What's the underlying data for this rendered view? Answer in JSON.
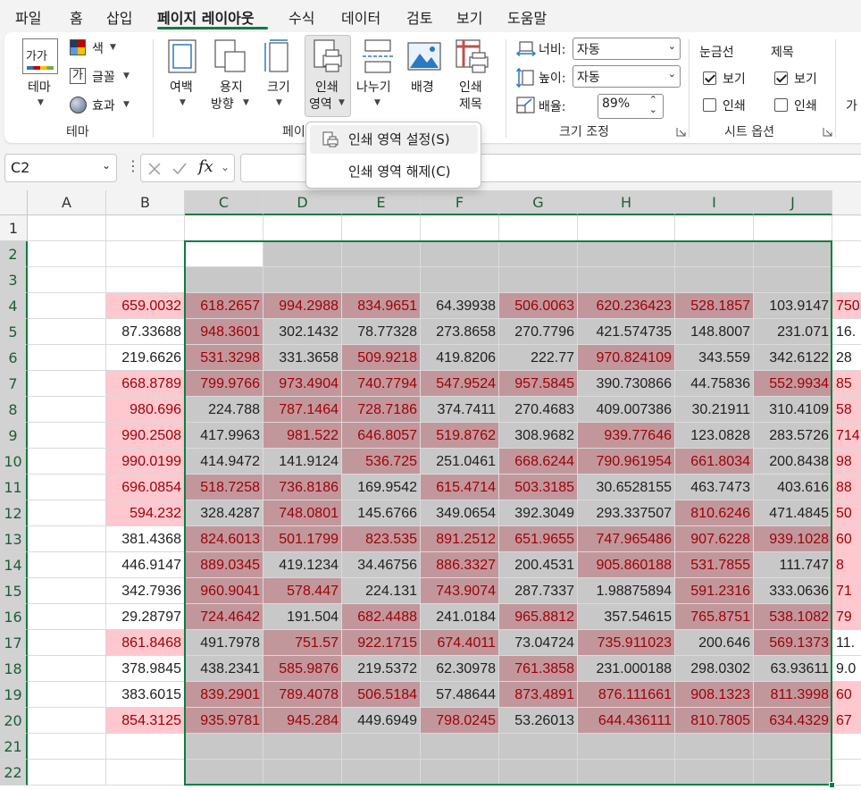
{
  "menu": {
    "tabs": [
      "파일",
      "홈",
      "삽입",
      "페이지 레이아웃",
      "수식",
      "데이터",
      "검토",
      "보기",
      "도움말"
    ],
    "active_index": 3
  },
  "ribbon": {
    "theme": {
      "main_label": "테마",
      "colors_label": "색",
      "fonts_label": "글꼴",
      "effects_label": "효과",
      "group_label": "테마",
      "thumb_text": "가가"
    },
    "page_setup": {
      "margins_label": "여백",
      "orientation_l1": "용지",
      "orientation_l2": "방향",
      "size_label": "크기",
      "print_area_l1": "인쇄",
      "print_area_l2": "영역",
      "breaks_label": "나누기",
      "background_label": "배경",
      "print_titles_l1": "인쇄",
      "print_titles_l2": "제목",
      "group_label_partial": "페이"
    },
    "scale": {
      "width_label": "너비:",
      "width_value": "자동",
      "height_label": "높이:",
      "height_value": "자동",
      "scale_label": "배율:",
      "scale_value": "89%",
      "group_label": "크기 조정"
    },
    "sheet_options": {
      "gridlines_label": "눈금선",
      "headings_label": "제목",
      "view_label": "보기",
      "print_label": "인쇄",
      "gridlines_view": true,
      "gridlines_print": false,
      "headings_view": true,
      "headings_print": false,
      "group_label": "시트 옵션"
    },
    "cut_label": "가"
  },
  "print_area_menu": {
    "set_label": "인쇄 영역 설정(S)",
    "clear_label": "인쇄 영역 해제(C)"
  },
  "formula_bar": {
    "name_box": "C2",
    "fx": "fx",
    "formula": ""
  },
  "grid": {
    "columns": [
      "A",
      "B",
      "C",
      "D",
      "E",
      "F",
      "G",
      "H",
      "I",
      "J"
    ],
    "rows": [
      "1",
      "2",
      "3",
      "4",
      "5",
      "6",
      "7",
      "8",
      "9",
      "10",
      "11",
      "12",
      "13",
      "14",
      "15",
      "16",
      "17",
      "18",
      "19",
      "20",
      "21",
      "22"
    ],
    "selection": "C2:J22",
    "data_rows": [
      {
        "row": "4",
        "values": [
          "659.0032",
          "618.2657",
          "994.2988",
          "834.9651",
          "64.39938",
          "506.0063",
          "620.236423",
          "528.1857",
          "103.9147",
          "750"
        ],
        "red": [
          1,
          1,
          1,
          1,
          0,
          1,
          1,
          1,
          0,
          1
        ]
      },
      {
        "row": "5",
        "values": [
          "87.33688",
          "948.3601",
          "302.1432",
          "78.77328",
          "273.8658",
          "270.7796",
          "421.574735",
          "148.8007",
          "231.071",
          "16."
        ],
        "red": [
          0,
          1,
          0,
          0,
          0,
          0,
          0,
          0,
          0,
          0
        ]
      },
      {
        "row": "6",
        "values": [
          "219.6626",
          "531.3298",
          "331.3658",
          "509.9218",
          "419.8206",
          "222.77",
          "970.824109",
          "343.559",
          "342.6122",
          "28"
        ],
        "red": [
          0,
          1,
          0,
          1,
          0,
          0,
          1,
          0,
          0,
          0
        ]
      },
      {
        "row": "7",
        "values": [
          "668.8789",
          "799.9766",
          "973.4904",
          "740.7794",
          "547.9524",
          "957.5845",
          "390.730866",
          "44.75836",
          "552.9934",
          "85"
        ],
        "red": [
          1,
          1,
          1,
          1,
          1,
          1,
          0,
          0,
          1,
          1
        ]
      },
      {
        "row": "8",
        "values": [
          "980.696",
          "224.788",
          "787.1464",
          "728.7186",
          "374.7411",
          "270.4683",
          "409.007386",
          "30.21911",
          "310.4109",
          "58"
        ],
        "red": [
          1,
          0,
          1,
          1,
          0,
          0,
          0,
          0,
          0,
          1
        ]
      },
      {
        "row": "9",
        "values": [
          "990.2508",
          "417.9963",
          "981.522",
          "646.8057",
          "519.8762",
          "308.9682",
          "939.77646",
          "123.0828",
          "283.5726",
          "714"
        ],
        "red": [
          1,
          0,
          1,
          1,
          1,
          0,
          1,
          0,
          0,
          1
        ]
      },
      {
        "row": "10",
        "values": [
          "990.0199",
          "414.9472",
          "141.9124",
          "536.725",
          "251.0461",
          "668.6244",
          "790.961954",
          "661.8034",
          "200.8438",
          "98"
        ],
        "red": [
          1,
          0,
          0,
          1,
          0,
          1,
          1,
          1,
          0,
          1
        ]
      },
      {
        "row": "11",
        "values": [
          "696.0854",
          "518.7258",
          "736.8186",
          "169.9542",
          "615.4714",
          "503.3185",
          "30.6528155",
          "463.7473",
          "403.616",
          "88"
        ],
        "red": [
          1,
          1,
          1,
          0,
          1,
          1,
          0,
          0,
          0,
          1
        ]
      },
      {
        "row": "12",
        "values": [
          "594.232",
          "328.4287",
          "748.0801",
          "145.6766",
          "349.0654",
          "392.3049",
          "293.337507",
          "810.6246",
          "471.4845",
          "50"
        ],
        "red": [
          1,
          0,
          1,
          0,
          0,
          0,
          0,
          1,
          0,
          1
        ]
      },
      {
        "row": "13",
        "values": [
          "381.4368",
          "824.6013",
          "501.1799",
          "823.535",
          "891.2512",
          "651.9655",
          "747.965486",
          "907.6228",
          "939.1028",
          "60"
        ],
        "red": [
          0,
          1,
          1,
          1,
          1,
          1,
          1,
          1,
          1,
          1
        ]
      },
      {
        "row": "14",
        "values": [
          "446.9147",
          "889.0345",
          "419.1234",
          "34.46756",
          "886.3327",
          "200.4531",
          "905.860188",
          "531.7855",
          "111.747",
          "8"
        ],
        "red": [
          0,
          1,
          0,
          0,
          1,
          0,
          1,
          1,
          0,
          1
        ]
      },
      {
        "row": "15",
        "values": [
          "342.7936",
          "960.9041",
          "578.447",
          "224.131",
          "743.9074",
          "287.7337",
          "1.98875894",
          "591.2316",
          "333.0636",
          "71"
        ],
        "red": [
          0,
          1,
          1,
          0,
          1,
          0,
          0,
          1,
          0,
          1
        ]
      },
      {
        "row": "16",
        "values": [
          "29.28797",
          "724.4642",
          "191.504",
          "682.4488",
          "241.0184",
          "965.8812",
          "357.54615",
          "765.8751",
          "538.1082",
          "79"
        ],
        "red": [
          0,
          1,
          0,
          1,
          0,
          1,
          0,
          1,
          1,
          1
        ]
      },
      {
        "row": "17",
        "values": [
          "861.8468",
          "491.7978",
          "751.57",
          "922.1715",
          "674.4011",
          "73.04724",
          "735.911023",
          "200.646",
          "569.1373",
          "11."
        ],
        "red": [
          1,
          0,
          1,
          1,
          1,
          0,
          1,
          0,
          1,
          0
        ]
      },
      {
        "row": "18",
        "values": [
          "378.9845",
          "438.2341",
          "585.9876",
          "219.5372",
          "62.30978",
          "761.3858",
          "231.000188",
          "298.0302",
          "63.93611",
          "9.0"
        ],
        "red": [
          0,
          0,
          1,
          0,
          0,
          1,
          0,
          0,
          0,
          0
        ]
      },
      {
        "row": "19",
        "values": [
          "383.6015",
          "839.2901",
          "789.4078",
          "506.5184",
          "57.48644",
          "873.4891",
          "876.111661",
          "908.1323",
          "811.3998",
          "60"
        ],
        "red": [
          0,
          1,
          1,
          1,
          0,
          1,
          1,
          1,
          1,
          1
        ]
      },
      {
        "row": "20",
        "values": [
          "854.3125",
          "935.9781",
          "945.284",
          "449.6949",
          "798.0245",
          "53.26013",
          "644.436111",
          "810.7805",
          "634.4329",
          "67"
        ],
        "red": [
          1,
          1,
          1,
          0,
          1,
          0,
          1,
          1,
          1,
          1
        ]
      }
    ]
  },
  "colors": {
    "accent": "#107c41",
    "bad_fill": "#ffc7ce",
    "bad_text": "#9c0006"
  }
}
